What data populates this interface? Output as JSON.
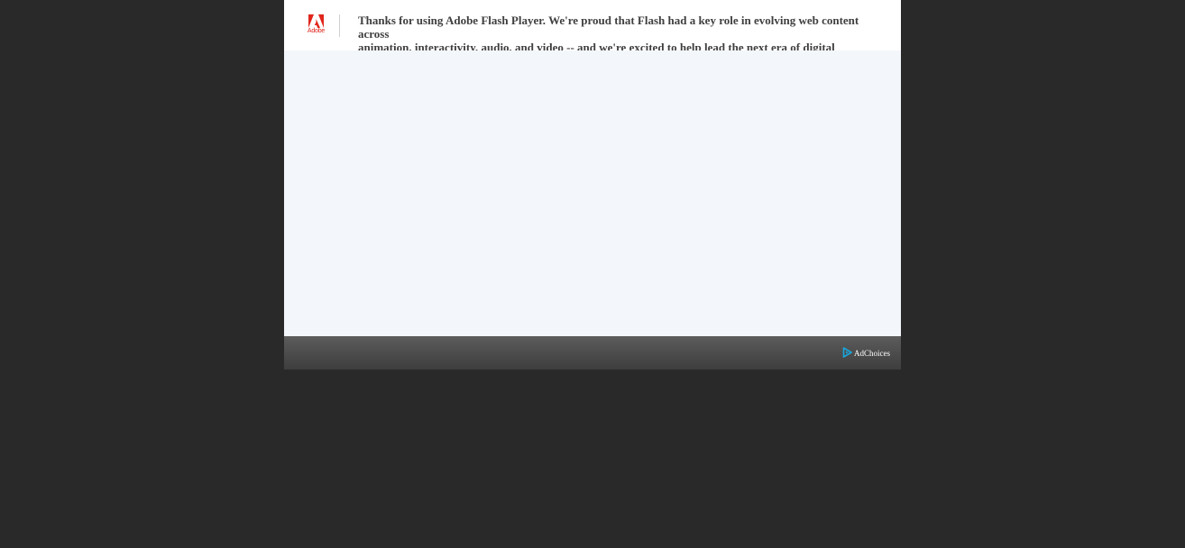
{
  "banner": {
    "brand": "Adobe",
    "message": "Thanks for using Adobe Flash Player. We're proud that Flash had a key role in evolving web content across\nanimation, interactivity, audio, and video -- and we're excited to help lead the next era of digital experiences."
  },
  "footer": {
    "adchoices_label": "AdChoices"
  },
  "icons": {
    "brand_logo": "adobe-logo-icon",
    "ad_marker": "adchoices-triangle-icon"
  },
  "colors": {
    "page_background": "#292929",
    "adobe_red": "#e1251b",
    "content_background": "#f3f6fa",
    "footer_bar": "#4b4b4b",
    "adchoices_blue": "#19a6dc",
    "message_text": "#3f3f3f"
  }
}
